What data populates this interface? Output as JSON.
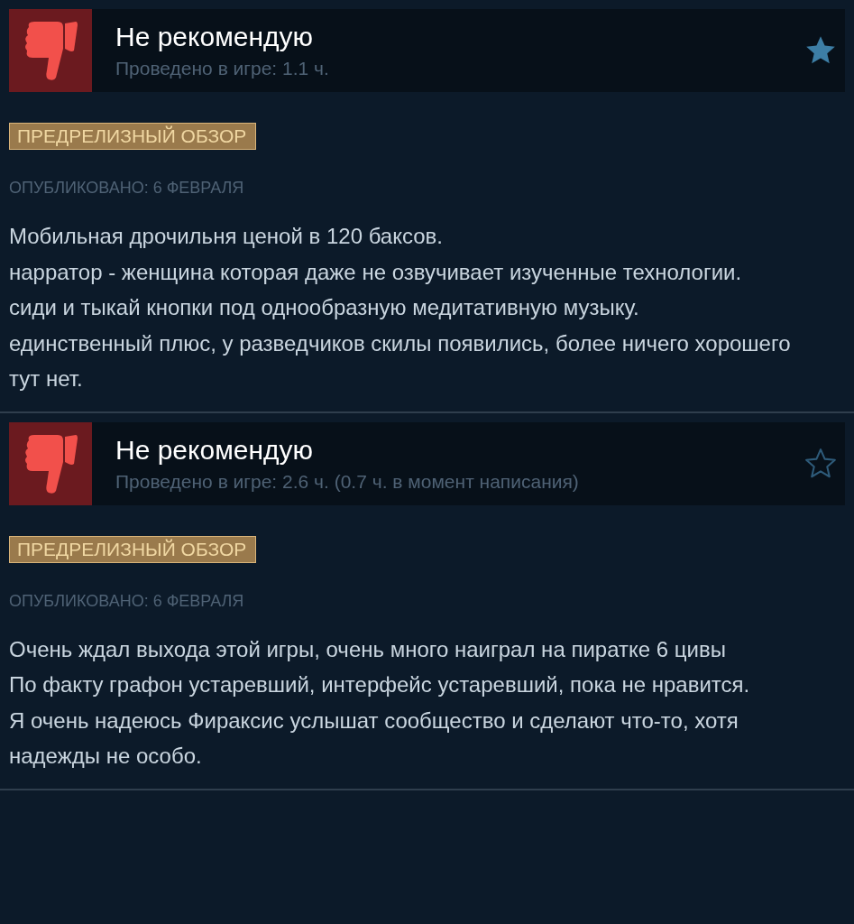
{
  "reviews": [
    {
      "verdict": "Не рекомендую",
      "playtime": "Проведено в игре: 1.1 ч.",
      "starred": true,
      "tag": "ПРЕДРЕЛИЗНЫЙ ОБЗОР",
      "posted": "ОПУБЛИКОВАНО: 6 ФЕВРАЛЯ",
      "paragraphs": [
        "Мобильная дрочильня ценой в 120 баксов.",
        "нарратор - женщина которая даже не озвучивает изученные технологии.",
        "сиди и тыкай кнопки под однообразную медитативную музыку.",
        "единственный плюс, у разведчиков скилы появились, более ничего хорошего тут нет."
      ]
    },
    {
      "verdict": "Не рекомендую",
      "playtime": "Проведено в игре: 2.6 ч. (0.7 ч. в момент написания)",
      "starred": false,
      "tag": "ПРЕДРЕЛИЗНЫЙ ОБЗОР",
      "posted": "ОПУБЛИКОВАНО: 6 ФЕВРАЛЯ",
      "paragraphs": [
        "Очень ждал выхода этой игры, очень много наиграл на пиратке 6 цивы",
        "По факту графон устаревший, интерфейс устаревший, пока не нравится.",
        "Я очень надеюсь Фираксис услышат сообщество и сделают что-то, хотя надежды не особо."
      ]
    }
  ]
}
